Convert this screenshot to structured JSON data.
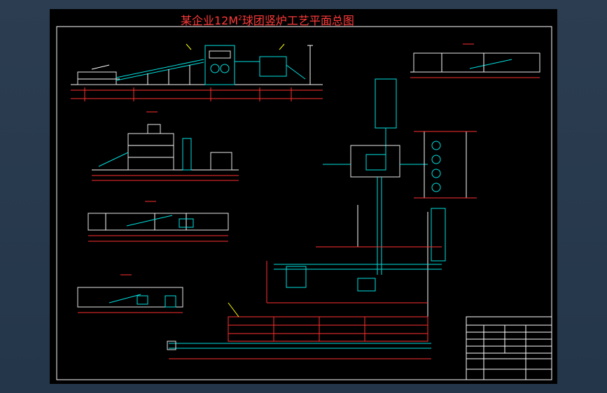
{
  "drawing": {
    "title_prefix": "某企业12M",
    "title_sup": "2",
    "title_suffix": "球团竖炉工艺平面总图"
  },
  "colors": {
    "background": "#000000",
    "frame": "#ffffff",
    "dimension": "#ff3030",
    "equipment": "#00e0e0",
    "structure": "#e8e8e8",
    "callout": "#ffff00",
    "viewport": "#2b3b4e"
  }
}
